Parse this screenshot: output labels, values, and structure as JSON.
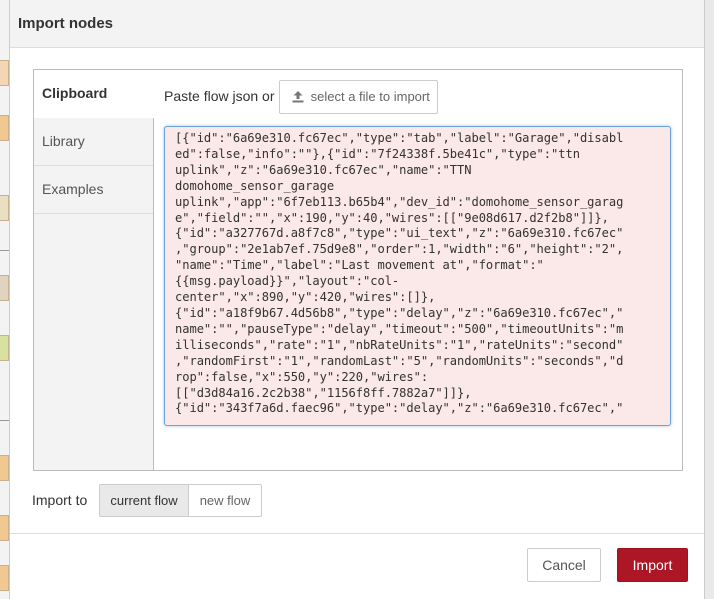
{
  "dialog": {
    "title": "Import nodes"
  },
  "tabs": [
    {
      "label": "Clipboard",
      "active": true
    },
    {
      "label": "Library",
      "active": false
    },
    {
      "label": "Examples",
      "active": false
    }
  ],
  "clipboard": {
    "paste_label": "Paste flow json or",
    "file_button_label": "select a file to import",
    "file_button_icon": "upload-icon",
    "json_lines": [
      "[{\"id\":\"6a69e310.fc67ec\",\"type\":\"tab\",\"label\":\"Garage\",\"disabl",
      "ed\":false,\"info\":\"\"},{\"id\":\"7f24338f.5be41c\",\"type\":\"ttn",
      "uplink\",\"z\":\"6a69e310.fc67ec\",\"name\":\"TTN",
      "domohome_sensor_garage",
      "uplink\",\"app\":\"6f7eb113.b65b4\",\"dev_id\":\"domohome_sensor_garag",
      "e\",\"field\":\"\",\"x\":190,\"y\":40,\"wires\":[[\"9e08d617.d2f2b8\"]]},",
      "{\"id\":\"a327767d.a8f7c8\",\"type\":\"ui_text\",\"z\":\"6a69e310.fc67ec\"",
      ",\"group\":\"2e1ab7ef.75d9e8\",\"order\":1,\"width\":\"6\",\"height\":\"2\",",
      "\"name\":\"Time\",\"label\":\"Last movement at\",\"format\":\"",
      "{{msg.payload}}\",\"layout\":\"col-",
      "center\",\"x\":890,\"y\":420,\"wires\":[]},",
      "{\"id\":\"a18f9b67.4d56b8\",\"type\":\"delay\",\"z\":\"6a69e310.fc67ec\",\"",
      "name\":\"\",\"pauseType\":\"delay\",\"timeout\":\"500\",\"timeoutUnits\":\"m",
      "illiseconds\",\"rate\":\"1\",\"nbRateUnits\":\"1\",\"rateUnits\":\"second\"",
      ",\"randomFirst\":\"1\",\"randomLast\":\"5\",\"randomUnits\":\"seconds\",\"d",
      "rop\":false,\"x\":550,\"y\":220,\"wires\":",
      "[[\"d3d84a16.2c2b38\",\"1156f8ff.7882a7\"]]},",
      "{\"id\":\"343f7a6d.faec96\",\"type\":\"delay\",\"z\":\"6a69e310.fc67ec\",\""
    ]
  },
  "import_to": {
    "label": "Import to",
    "options": [
      {
        "label": "current flow",
        "selected": true
      },
      {
        "label": "new flow",
        "selected": false
      }
    ]
  },
  "footer": {
    "cancel_label": "Cancel",
    "import_label": "Import"
  },
  "colors": {
    "import_button": "#ad1625",
    "json_background": "#fbe8e8",
    "json_border": "#6aa3d8"
  }
}
